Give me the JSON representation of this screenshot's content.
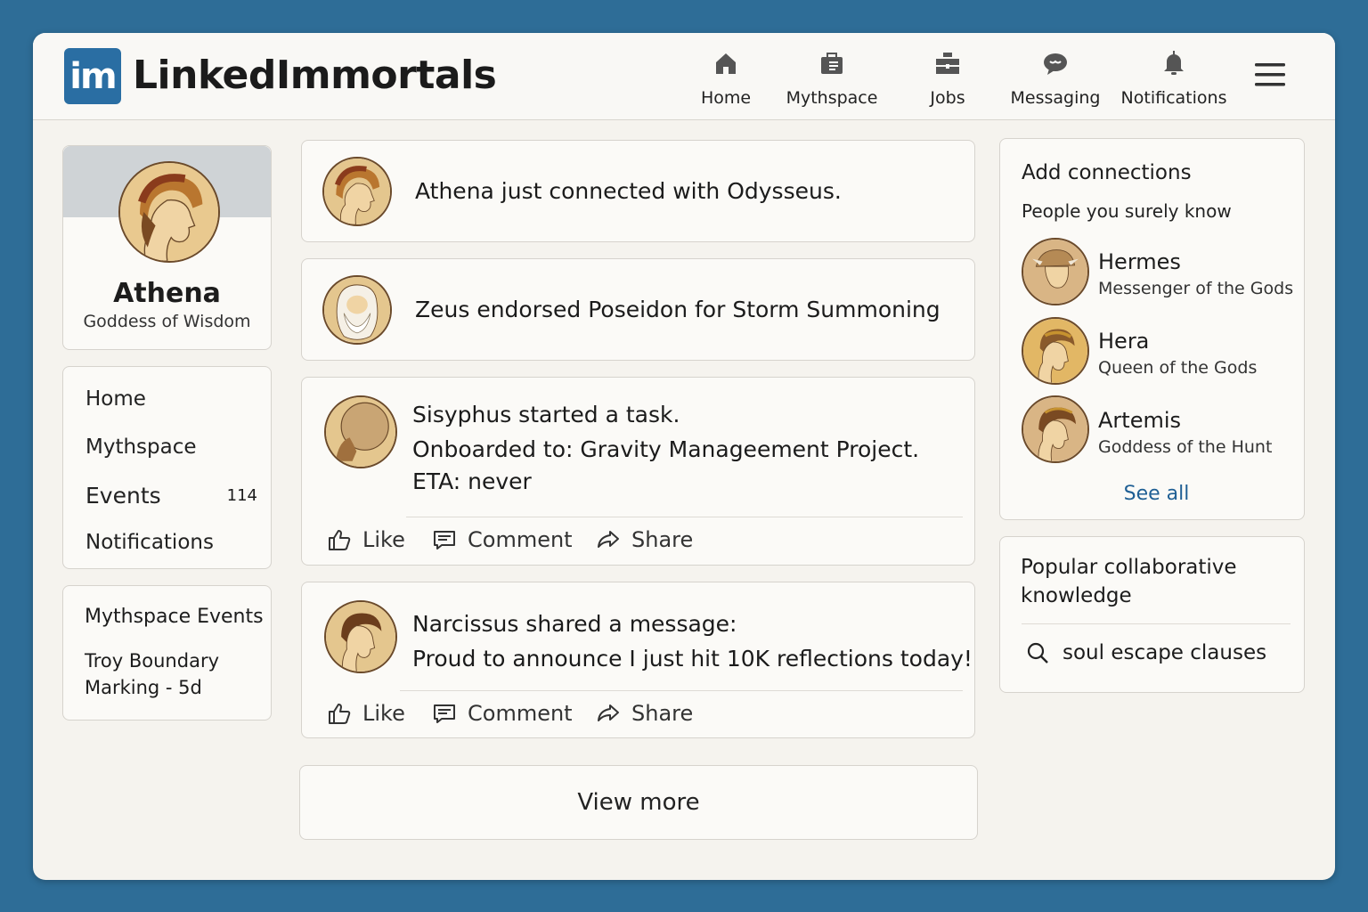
{
  "app": {
    "logo_text": "im",
    "brand": "LinkedImmortals"
  },
  "topnav": [
    {
      "label": "Home",
      "icon": "home-icon"
    },
    {
      "label": "Mythspace",
      "icon": "briefcase-icon"
    },
    {
      "label": "Jobs",
      "icon": "jobs-icon"
    },
    {
      "label": "Messaging",
      "icon": "chat-icon"
    },
    {
      "label": "Notifications",
      "icon": "bell-icon"
    }
  ],
  "profile": {
    "name": "Athena",
    "title": "Goddess of Wisdom"
  },
  "leftnav": {
    "items": [
      {
        "label": "Home"
      },
      {
        "label": "Mythspace"
      },
      {
        "label": "Events",
        "count": "114"
      },
      {
        "label": "Notifications"
      }
    ]
  },
  "events_card": {
    "heading": "Mythspace Events",
    "line1": "Troy Boundary",
    "line2": "Marking - 5d"
  },
  "feed": {
    "post1": {
      "text": "Athena just connected with Odysseus."
    },
    "post2": {
      "text": "Zeus endorsed Poseidon for Storm Summoning"
    },
    "post3": {
      "line1": "Sisyphus started a task.",
      "line2": "Onboarded to: Gravity Manageement Project.",
      "line3": "ETA: never"
    },
    "post4": {
      "line1": "Narcissus shared a message:",
      "line2": "Proud to announce I just hit 10K reflections today!"
    },
    "actions": {
      "like": "Like",
      "comment": "Comment",
      "share": "Share"
    },
    "view_more": "View more"
  },
  "connections": {
    "heading": "Add connections",
    "subheading": "People you surely know",
    "people": [
      {
        "name": "Hermes",
        "title": "Messenger of the Gods"
      },
      {
        "name": "Hera",
        "title": "Queen of the Gods"
      },
      {
        "name": "Artemis",
        "title": "Goddess of the Hunt"
      }
    ],
    "see_all": "See all"
  },
  "knowledge": {
    "heading_line1": "Popular collaborative",
    "heading_line2": "knowledge",
    "search_item": "soul escape clauses"
  },
  "colors": {
    "background": "#2e6d97",
    "brand_blue": "#2a6ea3",
    "link_blue": "#1f5f94",
    "avatar_gold": "#d9a24f"
  }
}
